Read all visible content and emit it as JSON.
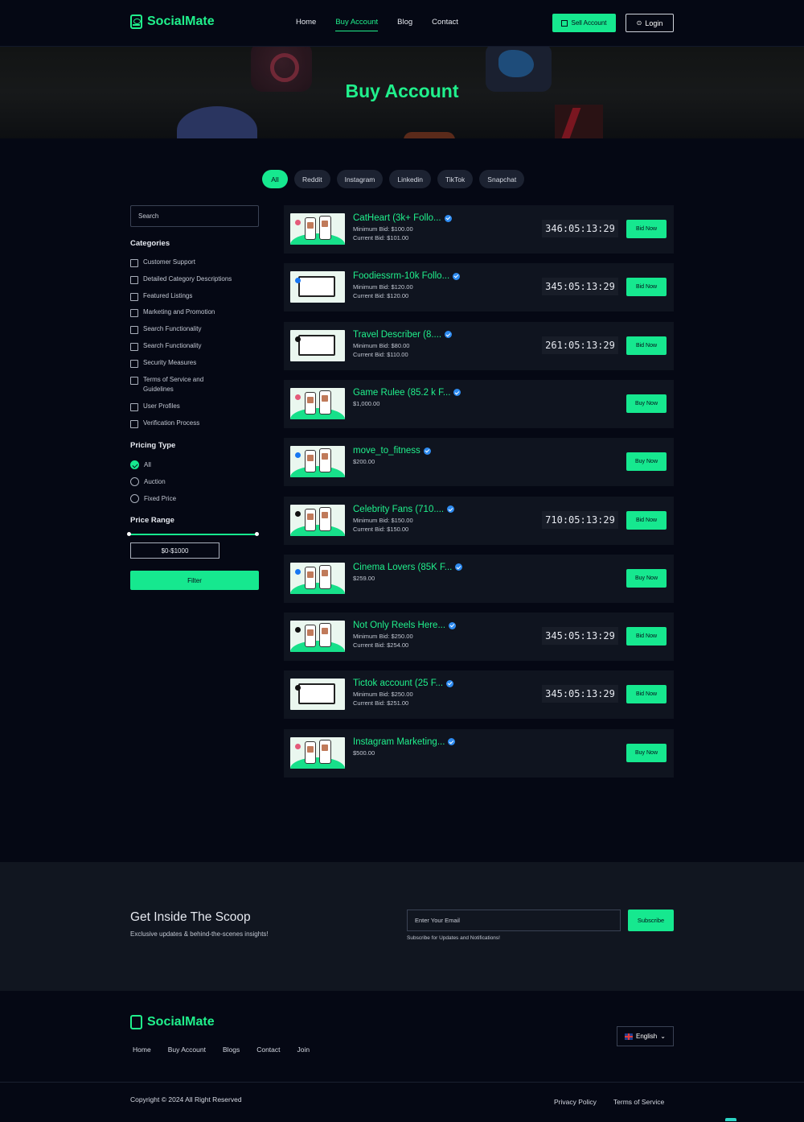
{
  "brand": {
    "name": "SocialMate"
  },
  "header": {
    "nav": [
      "Home",
      "Buy Account",
      "Blog",
      "Contact"
    ],
    "active_nav": "Buy Account",
    "sell_label": "Sell Account",
    "login_label": "Login"
  },
  "hero": {
    "title": "Buy Account"
  },
  "filters": [
    "All",
    "Reddit",
    "Instagram",
    "Linkedin",
    "TikTok",
    "Snapchat"
  ],
  "sidebar": {
    "search_placeholder": "Search",
    "categories_heading": "Categories",
    "categories": [
      "Customer Support",
      "Detailed Category Descriptions",
      "Featured Listings",
      "Marketing and Promotion",
      "Search Functionality",
      "Search Functionality",
      "Security Measures",
      "Terms of Service and Guidelines",
      "User Profiles",
      "Verification Process"
    ],
    "pricing_heading": "Pricing Type",
    "pricing": [
      "All",
      "Auction",
      "Fixed Price"
    ],
    "pricing_selected": "All",
    "range_heading": "Price Range",
    "range_value": "$0-$1000",
    "filter_label": "Filter"
  },
  "listings": [
    {
      "title": "CatHeart (3k+ Follo...",
      "line1": "Minimum Bid: $100.00",
      "line2": "Current Bid: $101.00",
      "timer": "346:05:13:29",
      "action": "Bid Now",
      "thumb": "insta"
    },
    {
      "title": "Foodiessrm-10k Follo...",
      "line1": "Minimum Bid: $120.00",
      "line2": "Current Bid: $120.00",
      "timer": "345:05:13:29",
      "action": "Bid Now",
      "thumb": "laptop-fb"
    },
    {
      "title": "Travel Describer (8....",
      "line1": "Minimum Bid: $80.00",
      "line2": "Current Bid: $110.00",
      "timer": "261:05:13:29",
      "action": "Bid Now",
      "thumb": "laptop-x"
    },
    {
      "title": "Game Rulee (85.2 k F...",
      "line1": "$1,000.00",
      "line2": "",
      "timer": "",
      "action": "Buy Now",
      "thumb": "insta"
    },
    {
      "title": "move_to_fitness",
      "line1": "$200.00",
      "line2": "",
      "timer": "",
      "action": "Buy Now",
      "thumb": "fb"
    },
    {
      "title": "Celebrity Fans (710....",
      "line1": "Minimum Bid: $150.00",
      "line2": "Current Bid: $150.00",
      "timer": "710:05:13:29",
      "action": "Bid Now",
      "thumb": "tiktok"
    },
    {
      "title": "Cinema Lovers (85K F...",
      "line1": "$259.00",
      "line2": "",
      "timer": "",
      "action": "Buy Now",
      "thumb": "fb"
    },
    {
      "title": "Not Only Reels Here...",
      "line1": "Minimum Bid: $250.00",
      "line2": "Current Bid: $254.00",
      "timer": "345:05:13:29",
      "action": "Bid Now",
      "thumb": "tiktok"
    },
    {
      "title": "Tictok account (25 F...",
      "line1": "Minimum Bid: $250.00",
      "line2": "Current Bid: $251.00",
      "timer": "345:05:13:29",
      "action": "Bid Now",
      "thumb": "laptop-x"
    },
    {
      "title": "Instagram Marketing...",
      "line1": "$500.00",
      "line2": "",
      "timer": "",
      "action": "Buy Now",
      "thumb": "insta"
    }
  ],
  "subscribe": {
    "title": "Get Inside The Scoop",
    "subtitle": "Exclusive updates & behind-the-scenes insights!",
    "email_placeholder": "Enter Your Email",
    "button": "Subscribe",
    "note": "Subscribe for Updates and Notifications!"
  },
  "footer": {
    "nav": [
      "Home",
      "Buy Account",
      "Blogs",
      "Contact",
      "Join"
    ],
    "language": "English",
    "copyright": "Copyright © 2024 All Right Reserved",
    "links": [
      "Privacy Policy",
      "Terms of Service"
    ]
  },
  "colors": {
    "accent": "#16e88f",
    "background": "#050814",
    "card": "#0f141f",
    "verified": "#2e8bf0"
  }
}
